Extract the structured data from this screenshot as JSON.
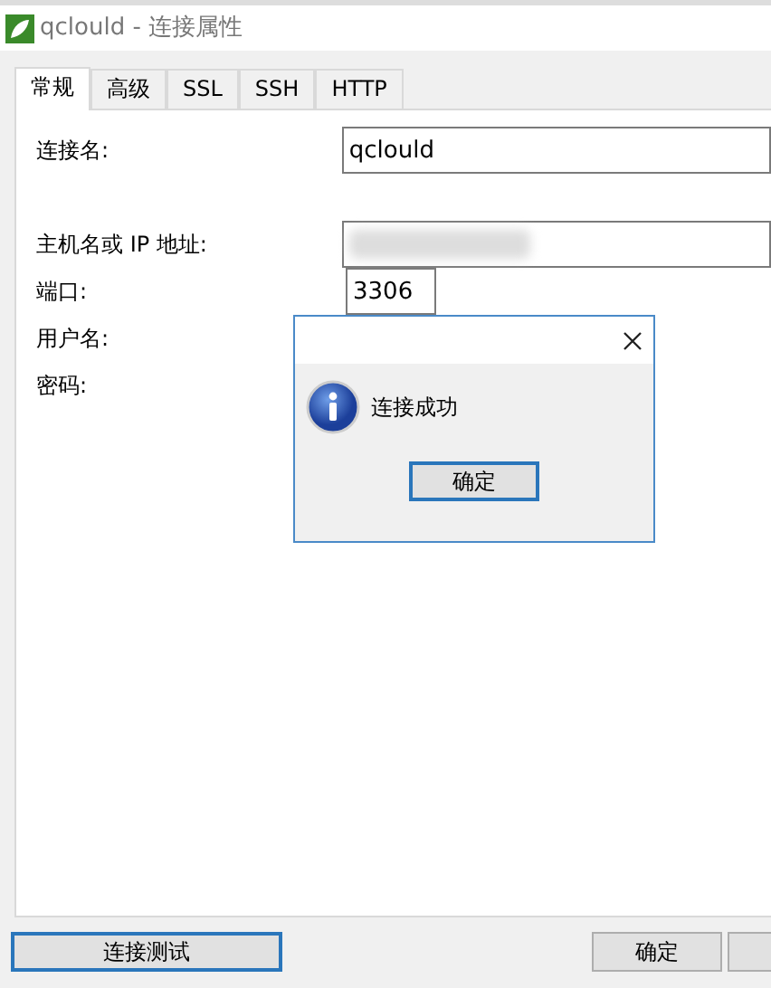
{
  "window": {
    "title": "qclould - 连接属性"
  },
  "tabs": [
    {
      "label": "常规",
      "selected": true
    },
    {
      "label": "高级",
      "selected": false
    },
    {
      "label": "SSL",
      "selected": false
    },
    {
      "label": "SSH",
      "selected": false
    },
    {
      "label": "HTTP",
      "selected": false
    }
  ],
  "fields": [
    {
      "label": "连接名:",
      "value": "qclould",
      "kind": "wide"
    },
    {
      "label": "主机名或 IP 地址:",
      "kind": "blurred"
    },
    {
      "label": "端口:",
      "value": "3306",
      "kind": "short"
    },
    {
      "label": "用户名:",
      "kind": "hidden"
    },
    {
      "label": "密码:",
      "kind": "hidden"
    }
  ],
  "dialog": {
    "message": "连接成功",
    "ok_button": "确定"
  },
  "footer": {
    "test_button": "连接测试",
    "ok_button": "确定"
  }
}
